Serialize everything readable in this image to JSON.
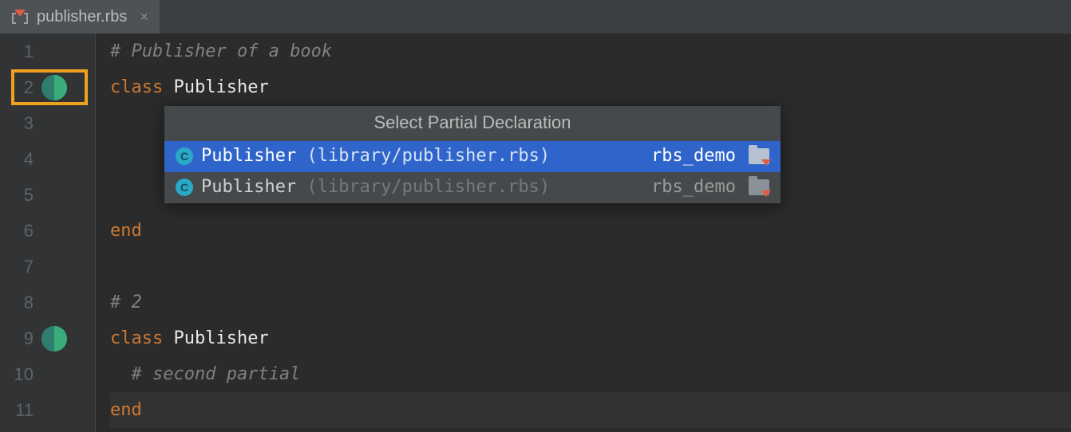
{
  "tab": {
    "filename": "publisher.rbs",
    "close_glyph": "×"
  },
  "lines": [
    {
      "num": "1",
      "tokens": [
        {
          "cls": "c-comment",
          "text": "# Publisher of a book"
        }
      ]
    },
    {
      "num": "2",
      "marker": true,
      "highlight": true,
      "tokens": [
        {
          "cls": "c-keyword",
          "text": "class "
        },
        {
          "cls": "c-class",
          "text": "Publisher"
        }
      ]
    },
    {
      "num": "3",
      "tokens": []
    },
    {
      "num": "4",
      "tokens": []
    },
    {
      "num": "5",
      "tokens": []
    },
    {
      "num": "6",
      "tokens": [
        {
          "cls": "c-keyword",
          "text": "end"
        }
      ]
    },
    {
      "num": "7",
      "tokens": []
    },
    {
      "num": "8",
      "tokens": [
        {
          "cls": "c-comment",
          "text": "# 2"
        }
      ]
    },
    {
      "num": "9",
      "marker": true,
      "tokens": [
        {
          "cls": "c-keyword",
          "text": "class "
        },
        {
          "cls": "c-class",
          "text": "Publisher"
        }
      ]
    },
    {
      "num": "10",
      "tokens": [
        {
          "cls": "c-comment",
          "text": "  # second partial"
        }
      ]
    },
    {
      "num": "11",
      "caret": true,
      "tokens": [
        {
          "cls": "c-keyword",
          "text": "end"
        }
      ]
    }
  ],
  "popup": {
    "title": "Select Partial Declaration",
    "icon_letter": "C",
    "items": [
      {
        "selected": true,
        "name": "Publisher",
        "path": "(library/publisher.rbs)",
        "module": "rbs_demo"
      },
      {
        "selected": false,
        "name": "Publisher",
        "path": "(library/publisher.rbs)",
        "module": "rbs_demo"
      }
    ]
  }
}
